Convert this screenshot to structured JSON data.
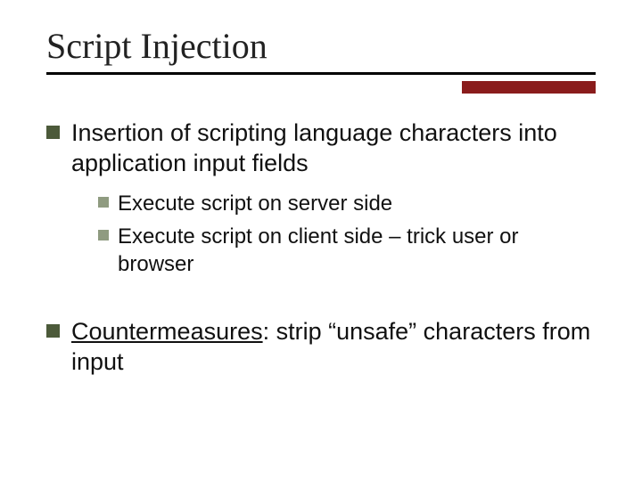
{
  "title": "Script Injection",
  "bullets": [
    {
      "text": "Insertion of scripting language characters into application input fields",
      "sub": [
        "Execute script on server side",
        "Execute script on client side – trick user or browser"
      ]
    },
    {
      "label": "Countermeasures",
      "rest": ": strip “unsafe” characters from input"
    }
  ],
  "colors": {
    "bullet_dark": "#4c5a3a",
    "bullet_light": "#8f9b80",
    "accent_bar": "#8a1c1c"
  }
}
